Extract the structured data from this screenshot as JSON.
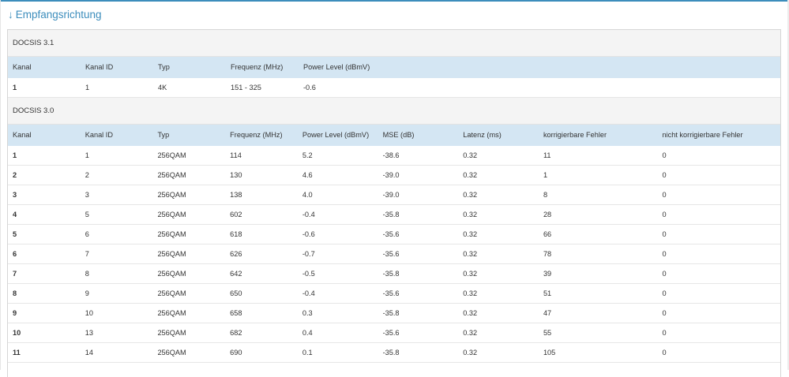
{
  "section": {
    "arrow": "↓",
    "title": "Empfangsrichtung"
  },
  "docsis31": {
    "heading": "DOCSIS 3.1",
    "headers": [
      "Kanal",
      "Kanal ID",
      "Typ",
      "Frequenz (MHz)",
      "Power Level (dBmV)"
    ],
    "rows": [
      [
        "1",
        "1",
        "4K",
        "151 - 325",
        "-0.6"
      ]
    ]
  },
  "docsis30": {
    "heading": "DOCSIS 3.0",
    "headers": [
      "Kanal",
      "Kanal ID",
      "Typ",
      "Frequenz (MHz)",
      "Power Level (dBmV)",
      "MSE (dB)",
      "Latenz (ms)",
      "korrigierbare Fehler",
      "nicht korrigierbare Fehler"
    ],
    "rows": [
      [
        "1",
        "1",
        "256QAM",
        "114",
        "5.2",
        "-38.6",
        "0.32",
        "11",
        "0"
      ],
      [
        "2",
        "2",
        "256QAM",
        "130",
        "4.6",
        "-39.0",
        "0.32",
        "1",
        "0"
      ],
      [
        "3",
        "3",
        "256QAM",
        "138",
        "4.0",
        "-39.0",
        "0.32",
        "8",
        "0"
      ],
      [
        "4",
        "5",
        "256QAM",
        "602",
        "-0.4",
        "-35.8",
        "0.32",
        "28",
        "0"
      ],
      [
        "5",
        "6",
        "256QAM",
        "618",
        "-0.6",
        "-35.6",
        "0.32",
        "66",
        "0"
      ],
      [
        "6",
        "7",
        "256QAM",
        "626",
        "-0.7",
        "-35.6",
        "0.32",
        "78",
        "0"
      ],
      [
        "7",
        "8",
        "256QAM",
        "642",
        "-0.5",
        "-35.8",
        "0.32",
        "39",
        "0"
      ],
      [
        "8",
        "9",
        "256QAM",
        "650",
        "-0.4",
        "-35.6",
        "0.32",
        "51",
        "0"
      ],
      [
        "9",
        "10",
        "256QAM",
        "658",
        "0.3",
        "-35.8",
        "0.32",
        "47",
        "0"
      ],
      [
        "10",
        "13",
        "256QAM",
        "682",
        "0.4",
        "-35.6",
        "0.32",
        "55",
        "0"
      ],
      [
        "11",
        "14",
        "256QAM",
        "690",
        "0.1",
        "-35.8",
        "0.32",
        "105",
        "0"
      ]
    ]
  },
  "colors": {
    "accent": "#3c8dbc",
    "header_bg": "#d4e6f3",
    "section_bg": "#f4f4f4"
  }
}
